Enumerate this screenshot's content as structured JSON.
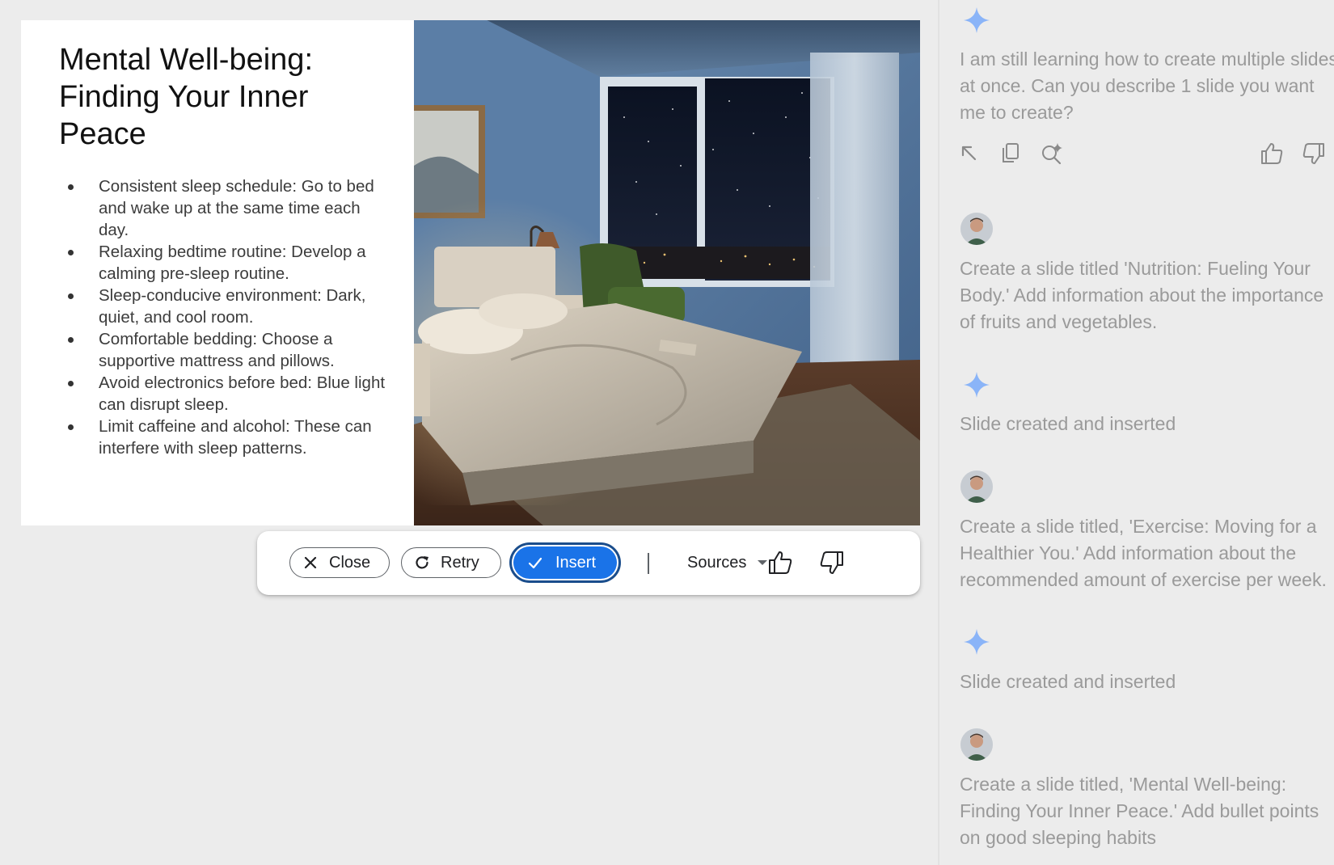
{
  "slide": {
    "title": "Mental Well-being: Finding Your Inner Peace",
    "bullets": [
      "Consistent sleep schedule: Go to bed and wake up at the same time each day.",
      "Relaxing bedtime routine: Develop a calming pre-sleep routine.",
      "Sleep-conducive environment: Dark, quiet, and cool room.",
      "Comfortable bedding: Choose a supportive mattress and pillows.",
      "Avoid electronics before bed: Blue light can disrupt sleep.",
      "Limit caffeine and alcohol: These can interfere with sleep patterns."
    ],
    "image": "bedroom-night-image"
  },
  "toolbar": {
    "close_label": "Close",
    "retry_label": "Retry",
    "insert_label": "Insert",
    "sources_label": "Sources",
    "accent": "#1a73e8"
  },
  "chat": {
    "messages": [
      {
        "role": "assistant",
        "text": "I am still learning how to create multiple slides at once. Can you describe 1 slide you want me to create?"
      },
      {
        "role": "user",
        "text": "Create a slide titled 'Nutrition: Fueling Your Body.' Add information about the importance of fruits and vegetables."
      },
      {
        "role": "assistant",
        "text": "Slide created and inserted"
      },
      {
        "role": "user",
        "text": "Create a slide titled, 'Exercise: Moving for a Healthier You.' Add information about the recommended amount of exercise per week."
      },
      {
        "role": "assistant",
        "text": "Slide created and inserted"
      },
      {
        "role": "user",
        "text": "Create a slide titled, 'Mental Well-being: Finding Your Inner Peace.' Add bullet points on good sleeping habits"
      }
    ],
    "action_icons": [
      "expand-icon",
      "copy-icon",
      "refine-icon",
      "thumb-up-icon",
      "thumb-down-icon"
    ],
    "text_color": "#9a9a9a",
    "sparkle_color": "#8ab4f8"
  }
}
